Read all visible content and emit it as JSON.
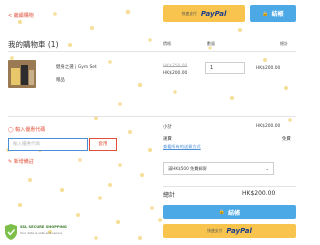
{
  "top": {
    "continue_shopping": "< 繼續購物",
    "paypal_prefix": "快速支付",
    "paypal_label": "PayPal",
    "checkout_label": "結帳"
  },
  "cart": {
    "title": "我的購物車 (1)",
    "col_price": "價格",
    "col_qty": "數量",
    "col_total": "總計",
    "item": {
      "name": "健身之選 | Gym Set",
      "original_price": "HK$250.00",
      "price": "HK$200.00",
      "quantity": "1",
      "total": "HK$200.00",
      "gift_note": "贈品"
    }
  },
  "promo": {
    "toggle_label": "輸入優惠代碼",
    "input_placeholder": "輸入優惠代碼",
    "apply_label": "套用",
    "note_label": "新增備註"
  },
  "summary": {
    "subtotal_label": "小計",
    "subtotal_value": "HK$200.00",
    "shipping_label": "運費",
    "shipping_value": "免費",
    "shipping_link": "查看所有的送貨方式",
    "shipping_note": "滿HK$500 免費郵寄",
    "total_label": "總計",
    "total_value": "HK$200.00"
  },
  "badge": {
    "title": "SSL SECURE SHOPPING",
    "subtitle": "Your data is safe and secure"
  },
  "colors": {
    "accent": "#e2513b",
    "checkout_blue": "#4da8e6",
    "paypal_yellow": "#f8c44e"
  }
}
